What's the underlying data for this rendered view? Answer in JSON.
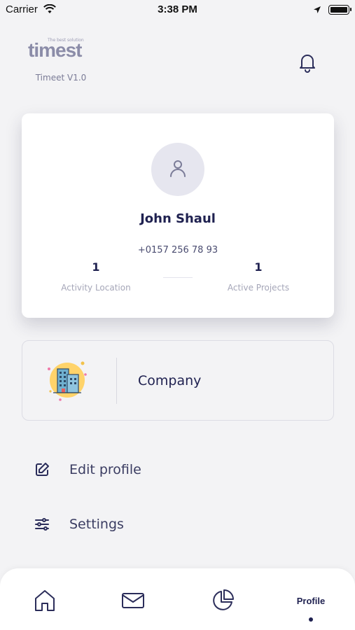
{
  "status_bar": {
    "carrier": "Carrier",
    "time": "3:38 PM",
    "battery_level": 1.0
  },
  "header": {
    "logo_text": "timest",
    "logo_tagline": "The best solution",
    "version": "Timeet V1.0",
    "bell_icon": "bell-icon"
  },
  "profile_card": {
    "avatar_icon": "user-icon",
    "name": "John Shaul",
    "phone": "+0157 256 78 93",
    "stats": [
      {
        "value": "1",
        "label": "Activity Location"
      },
      {
        "value": "1",
        "label": "Active Projects"
      }
    ]
  },
  "company": {
    "label": "Company",
    "icon": "building-illustration"
  },
  "menu": [
    {
      "label": "Edit profile",
      "icon": "edit-icon"
    },
    {
      "label": "Settings",
      "icon": "sliders-icon"
    }
  ],
  "tab_bar": {
    "tabs": [
      {
        "id": "home",
        "icon": "home-icon"
      },
      {
        "id": "messages",
        "icon": "mail-icon"
      },
      {
        "id": "stats",
        "icon": "pie-chart-icon"
      },
      {
        "id": "profile",
        "label": "Profile",
        "active": true
      }
    ]
  },
  "colors": {
    "primary": "#1f2150",
    "background": "#f3f3f5",
    "muted": "#a5a6b8",
    "accent_illustration": "#ffd36a"
  }
}
